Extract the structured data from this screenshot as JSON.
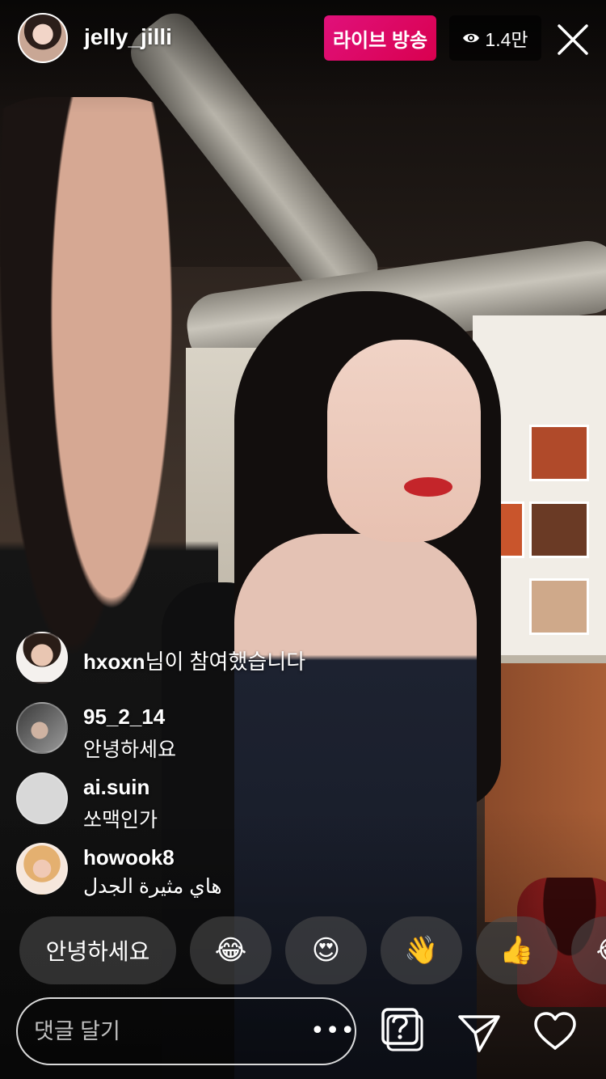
{
  "header": {
    "host_username": "jelly_jilli",
    "live_label": "라이브 방송",
    "viewer_count": "1.4만"
  },
  "comments": [
    {
      "type": "join",
      "username": "hxoxn",
      "suffix": "님이 참여했습니다"
    },
    {
      "type": "comment",
      "username": "95_2_14",
      "text": "안녕하세요"
    },
    {
      "type": "comment",
      "username": "ai.suin",
      "text": "쏘맥인가"
    },
    {
      "type": "comment",
      "username": "howook8",
      "text": "هاي مثيرة الجدل"
    }
  ],
  "quick_reactions": {
    "text_chip": "안녕하세요",
    "emojis": [
      "😂",
      "😍",
      "👋",
      "👍",
      "😂"
    ]
  },
  "composer": {
    "placeholder": "댓글 달기",
    "more": "•••"
  },
  "icons": {
    "close": "close-icon",
    "eye": "eye-icon",
    "question": "question-box-icon",
    "send": "paper-plane-icon",
    "heart": "heart-icon"
  },
  "colors": {
    "live_badge": "#d9004f",
    "chip_bg": "#505050"
  }
}
